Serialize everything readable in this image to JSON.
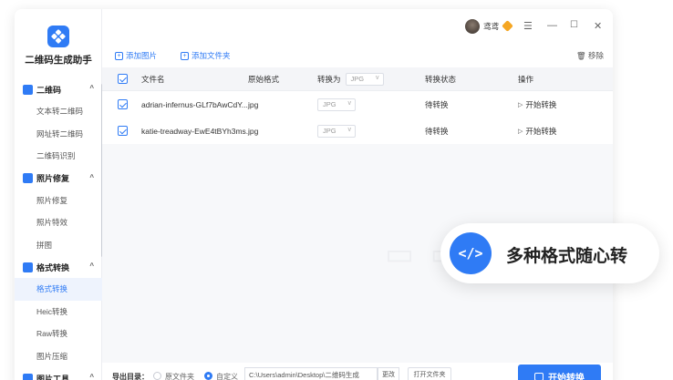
{
  "app": {
    "title": "二维码生成助手"
  },
  "user": {
    "name": "鸢鸢"
  },
  "colors": {
    "accent": "#2f7bf5",
    "vip": "#f5a623"
  },
  "sidebar": {
    "groups": [
      {
        "label": "二维码",
        "items": [
          "文本转二维码",
          "网址转二维码",
          "二维码识别"
        ]
      },
      {
        "label": "照片修复",
        "items": [
          "照片修复",
          "照片特效",
          "拼图"
        ]
      },
      {
        "label": "格式转换",
        "items": [
          "格式转换",
          "Heic转换",
          "Raw转换",
          "图片压缩"
        ]
      },
      {
        "label": "图片工具",
        "items": []
      }
    ],
    "active_item": "格式转换"
  },
  "toolbar": {
    "add_image": "添加图片",
    "add_folder": "添加文件夹",
    "remove": "移除"
  },
  "table": {
    "headers": {
      "name": "文件名",
      "format": "原始格式",
      "convert_to": "转换为",
      "status": "转换状态",
      "action": "操作"
    },
    "head_select": "JPG",
    "rows": [
      {
        "name": "adrian-infernus-GLf7bAwCdY...",
        "format": "jpg",
        "target": "JPG",
        "status": "待转换",
        "action": "开始转换"
      },
      {
        "name": "katie-treadway-EwE4tBYh3ms...",
        "format": "jpg",
        "target": "JPG",
        "status": "待转换",
        "action": "开始转换"
      }
    ]
  },
  "footer": {
    "label": "导出目录：",
    "option_original": "原文件夹",
    "option_custom": "自定义",
    "path": "C:\\Users\\admin\\Desktop\\二维码生成",
    "change": "更改",
    "open_folder": "打开文件夹",
    "start_all": "开始转换"
  },
  "promo": {
    "icon": "</>",
    "text": "多种格式随心转"
  }
}
